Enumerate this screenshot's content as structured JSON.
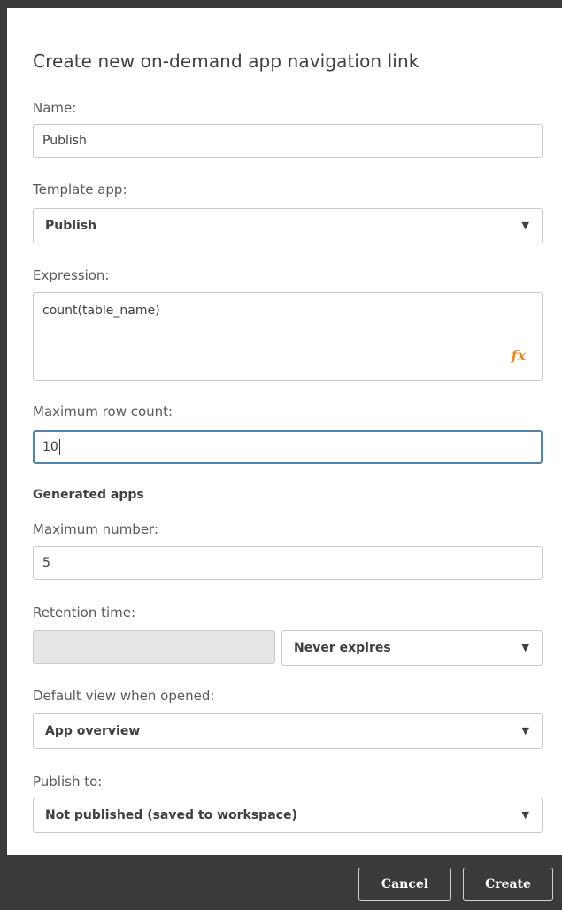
{
  "dialog": {
    "title": "Create new on-demand app navigation link"
  },
  "name": {
    "label": "Name:",
    "value": "Publish"
  },
  "template_app": {
    "label": "Template app:",
    "selected": "Publish"
  },
  "expression": {
    "label": "Expression:",
    "value": "count(table_name)",
    "fx_icon": "fx"
  },
  "max_row_count": {
    "label": "Maximum row count:",
    "value": "10"
  },
  "generated_apps": {
    "section_title": "Generated apps",
    "max_number_label": "Maximum number:",
    "max_number_value": "5",
    "retention_label": "Retention time:",
    "retention_value": "",
    "retention_selected": "Never expires",
    "default_view_label": "Default view when opened:",
    "default_view_selected": "App overview",
    "publish_to_label": "Publish to:",
    "publish_to_selected": "Not published (saved to workspace)"
  },
  "footer": {
    "cancel_label": "Cancel",
    "create_label": "Create"
  },
  "icons": {
    "dropdown": "▼"
  },
  "colors": {
    "accent_focus": "#4a86b4",
    "fx_orange": "#e88a1a",
    "footer_bg": "#3a3a3a"
  }
}
